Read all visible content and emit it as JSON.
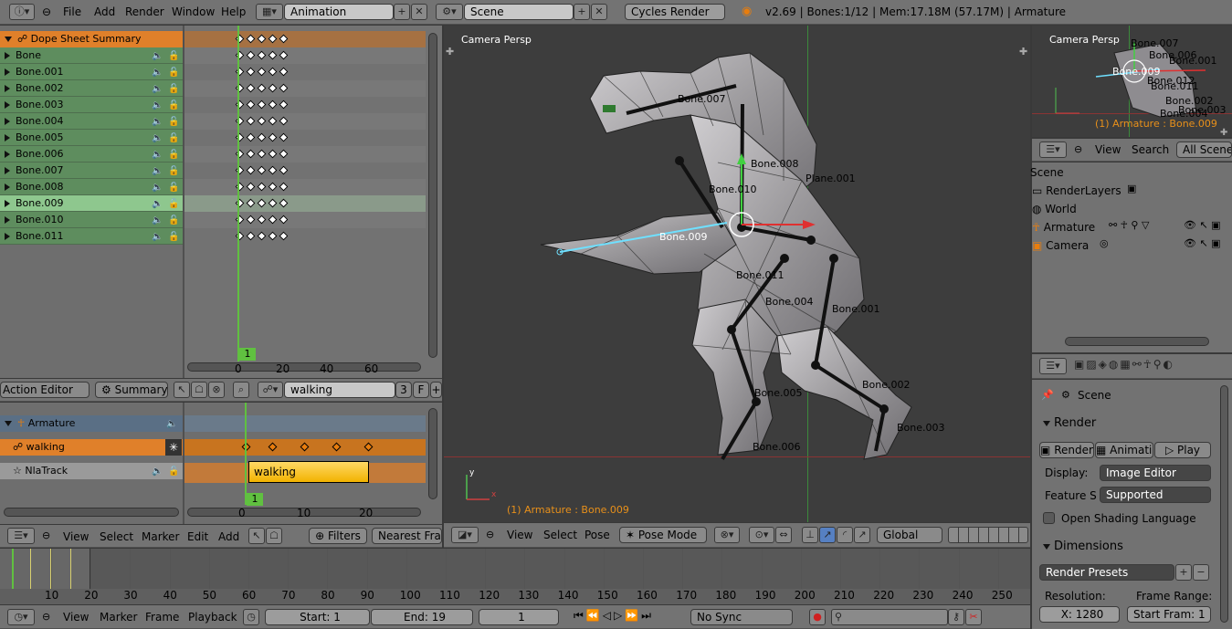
{
  "topbar": {
    "menus": [
      "File",
      "Add",
      "Render",
      "Window",
      "Help"
    ],
    "screen_layout": "Animation",
    "scene": "Scene",
    "engine": "Cycles Render",
    "info": "v2.69 | Bones:1/12 | Mem:17.18M (57.17M) | Armature"
  },
  "dopesheet": {
    "summary": "Dope Sheet Summary",
    "channels": [
      "Bone",
      "Bone.001",
      "Bone.002",
      "Bone.003",
      "Bone.004",
      "Bone.005",
      "Bone.006",
      "Bone.007",
      "Bone.008",
      "Bone.009",
      "Bone.010",
      "Bone.011"
    ],
    "selected_index": 9,
    "current_frame": "1",
    "ticks": [
      "0",
      "20",
      "40",
      "60"
    ],
    "header": {
      "mode": "Action Editor",
      "summary": "Summary",
      "action": "walking",
      "users": "3",
      "fake": "F"
    }
  },
  "nla": {
    "armature": "Armature",
    "action": "walking",
    "track": "NlaTrack",
    "strip": "walking",
    "current_frame": "1",
    "ticks": [
      "0",
      "10",
      "20"
    ],
    "header": {
      "menus": [
        "View",
        "Select",
        "Marker",
        "Edit",
        "Add"
      ],
      "filters": "Filters",
      "snap": "Nearest Fram"
    }
  },
  "viewport": {
    "label": "Camera Persp",
    "status": "(1) Armature : Bone.009",
    "bones": [
      "Bone.007",
      "Bone.008",
      "Bone.010",
      "Plane.001",
      "Bone.009",
      "Bone.011",
      "Bone.004",
      "Bone.001",
      "Bone.005",
      "Bone.002",
      "Bone.003",
      "Bone.006"
    ],
    "header": {
      "menus": [
        "View",
        "Select",
        "Pose"
      ],
      "mode": "Pose Mode",
      "orientation": "Global"
    }
  },
  "camera_view": {
    "label": "Camera Persp",
    "status": "(1) Armature : Bone.009",
    "bones": [
      "Bone.007",
      "Bone.006",
      "Bone.001",
      "Bone.009",
      "Bone.012",
      "Bone.011",
      "Bone.002",
      "Bone.003",
      "Bone.004"
    ]
  },
  "outliner": {
    "header": {
      "menus": [
        "View",
        "Search"
      ],
      "filter": "All Scenes"
    },
    "items": [
      "Scene",
      "RenderLayers",
      "World",
      "Armature",
      "Camera"
    ]
  },
  "properties": {
    "scene": "Scene",
    "render_panel": "Render",
    "render_btn": "Render",
    "anim_btn": "Animation",
    "play_btn": "Play",
    "display_label": "Display:",
    "display_value": "Image Editor",
    "feature_label": "Feature S",
    "feature_value": "Supported",
    "osl": "Open Shading Language",
    "dimensions": "Dimensions",
    "presets": "Render Presets",
    "resolution_label": "Resolution:",
    "frame_range_label": "Frame Range:",
    "res_x": "X: 1280",
    "start_frame": "Start Fram: 1"
  },
  "timeline": {
    "ticks": [
      "10",
      "20",
      "30",
      "40",
      "50",
      "60",
      "70",
      "80",
      "90",
      "100",
      "110",
      "120",
      "130",
      "140",
      "150",
      "160",
      "170",
      "180",
      "190",
      "200",
      "210",
      "220",
      "230",
      "240",
      "250"
    ],
    "menus": [
      "View",
      "Marker",
      "Frame",
      "Playback"
    ],
    "start": "Start: 1",
    "end": "End: 19",
    "current": "1",
    "sync": "No Sync"
  },
  "colors": {
    "accent": "#e87d0d",
    "channel": "#5e8d5e",
    "selected": "#8ec78e",
    "keyframe": "#ffffff",
    "playhead": "#60c040"
  }
}
